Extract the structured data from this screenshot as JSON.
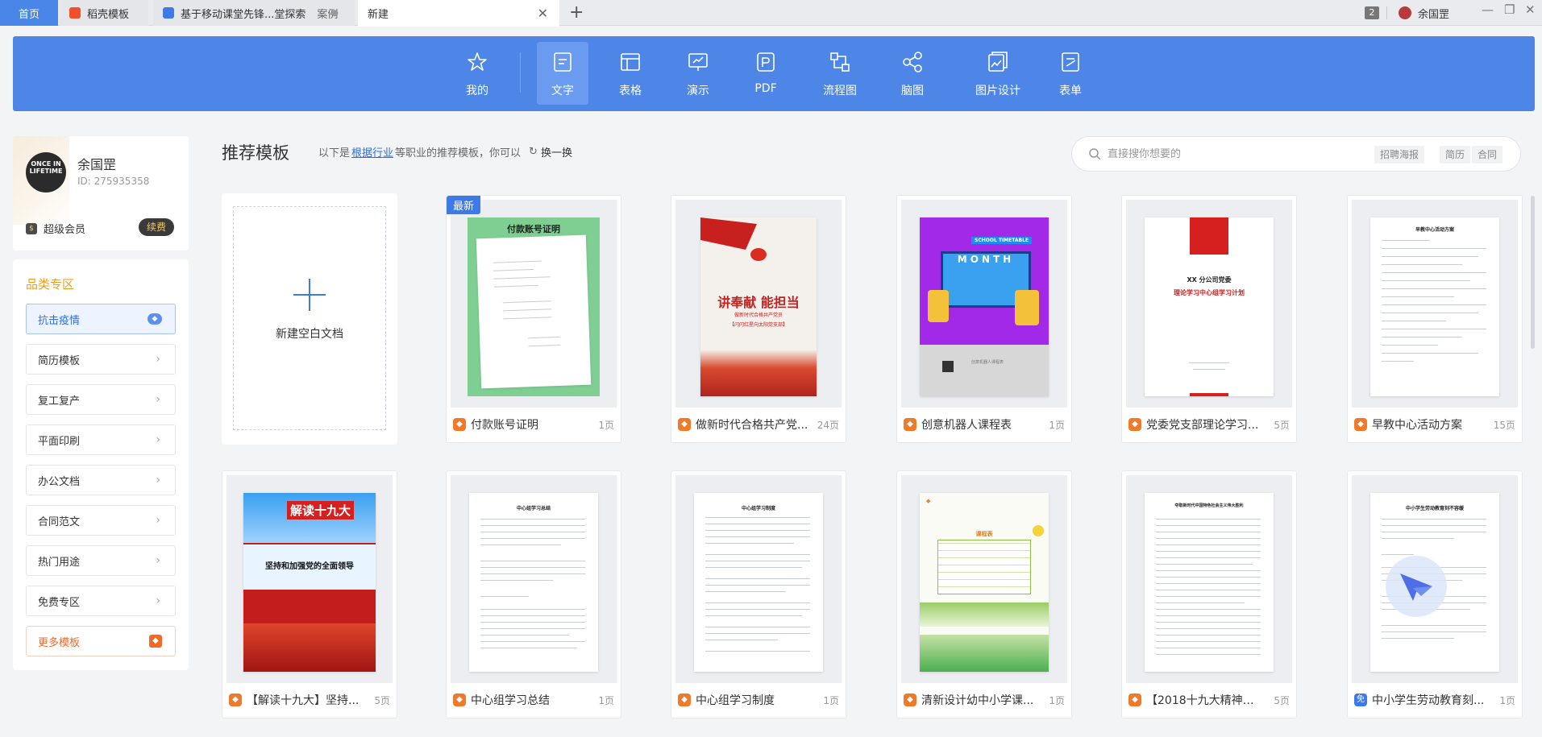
{
  "tabs": {
    "home": "首页",
    "docer": "稻壳模板",
    "doc_title": "基于移动课堂先锋...堂探索",
    "doc_sub": "案例",
    "new_tab": "新建",
    "count": "2",
    "user": "余国罡"
  },
  "toolbar": {
    "items": [
      {
        "label": "我的",
        "icon": "star-icon"
      },
      {
        "label": "文字",
        "icon": "document-icon"
      },
      {
        "label": "表格",
        "icon": "table-icon"
      },
      {
        "label": "演示",
        "icon": "presentation-icon"
      },
      {
        "label": "PDF",
        "icon": "pdf-icon"
      },
      {
        "label": "流程图",
        "icon": "flowchart-icon"
      },
      {
        "label": "脑图",
        "icon": "mindmap-icon"
      },
      {
        "label": "图片设计",
        "icon": "image-design-icon"
      },
      {
        "label": "表单",
        "icon": "form-icon"
      }
    ]
  },
  "user": {
    "name": "余国罡",
    "id": "ID: 275935358",
    "member": "超级会员",
    "renew": "续费",
    "avatar_text": "ONCE IN LIFETIME"
  },
  "categories": {
    "title": "品类专区",
    "items": [
      "抗击疫情",
      "简历模板",
      "复工复产",
      "平面印刷",
      "办公文档",
      "合同范文",
      "热门用途",
      "免费专区",
      "更多模板"
    ]
  },
  "recommend": {
    "title": "推荐模板",
    "desc_pre": "以下是",
    "desc_link": "根据行业",
    "desc_post": "等职业的推荐模板，你可以",
    "refresh": "换一换"
  },
  "search": {
    "placeholder": "直接搜你想要的",
    "chips": [
      "招聘海报",
      "简历",
      "合同"
    ]
  },
  "blank": {
    "label": "新建空白文档"
  },
  "cards": [
    {
      "name": "付款账号证明",
      "pages": "1页",
      "tag": "最新",
      "thumb_title": "付款账号证明"
    },
    {
      "name": "做新时代合格共产党...",
      "pages": "24页",
      "thumb_title": "讲奉献 能担当",
      "thumb_sub": "做新时代合格共产党员",
      "thumb_foot": "【闪闪红星向太阳党支部】"
    },
    {
      "name": "创意机器人课程表",
      "pages": "1页",
      "thumb_title": "MONTH",
      "thumb_badge": "SCHOOL TIMETABLE",
      "thumb_foot": "创意机器人课程表"
    },
    {
      "name": "党委党支部理论学习...",
      "pages": "5页",
      "thumb_title": "XX 分公司党委",
      "thumb_sub": "理论学习中心组学习计划"
    },
    {
      "name": "早教中心活动方案",
      "pages": "15页",
      "thumb_title": "早教中心活动方案"
    },
    {
      "name": "【解读十九大】坚持...",
      "pages": "5页",
      "thumb_title": "解读十九大",
      "thumb_sub": "坚持和加强党的全面领导"
    },
    {
      "name": "中心组学习总结",
      "pages": "1页",
      "thumb_title": "中心组学习总结"
    },
    {
      "name": "中心组学习制度",
      "pages": "1页",
      "thumb_title": "中心组学习制度"
    },
    {
      "name": "清新设计幼中小学课...",
      "pages": "1页",
      "thumb_title": "课程表"
    },
    {
      "name": "【2018十九大精神学...",
      "pages": "5页",
      "thumb_title": "夺取新时代中国特色社会主义伟大胜利"
    },
    {
      "name": "中小学生劳动教育刻...",
      "pages": "1页",
      "thumb_title": "中小学生劳动教育刻不容缓"
    }
  ],
  "colors": {
    "accent": "#4e86e8",
    "orange": "#f0a020",
    "brand": "#f07a2a"
  }
}
